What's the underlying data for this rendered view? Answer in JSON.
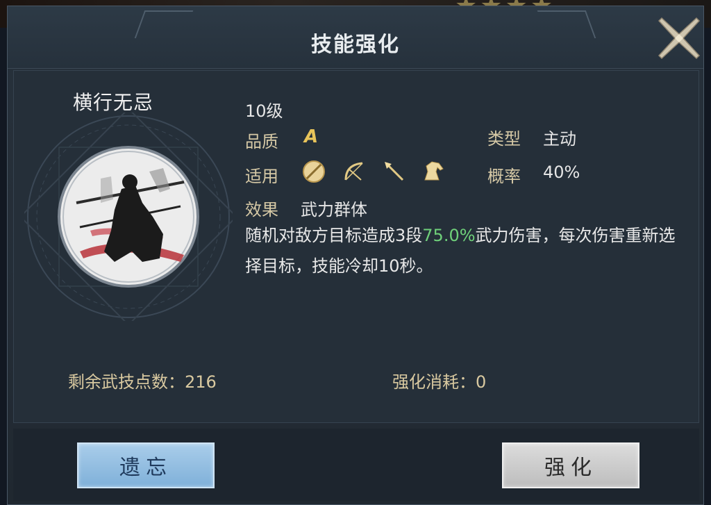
{
  "window": {
    "title": "技能强化"
  },
  "skill": {
    "name": "横行无忌",
    "level": "10级",
    "quality_label": "品质",
    "quality_value": "A",
    "type_label": "类型",
    "type_value": "主动",
    "apply_label": "适用",
    "apply_icons": [
      "shield-icon",
      "bow-icon",
      "spear-icon",
      "horse-icon"
    ],
    "rate_label": "概率",
    "rate_value": "40%",
    "effect_label": "效果",
    "effect_value": "武力群体",
    "desc_prefix": "随机对敌方目标造成3段",
    "desc_highlight": "75.0%",
    "desc_suffix": "武力伤害，每次伤害重新选择目标，技能冷却10秒。"
  },
  "stats": {
    "remaining_points_label": "剩余武技点数：",
    "remaining_points_value": "216",
    "cost_label": "强化消耗：",
    "cost_value": "0"
  },
  "buttons": {
    "forget_label": "遗忘",
    "enhance_label": "强化"
  },
  "colors": {
    "highlight": "#6fd07a",
    "quality": "#e8c45a",
    "label": "#d6c9a6",
    "forget_button": "#9cc4e6",
    "enhance_button": "#cfcfcf"
  }
}
